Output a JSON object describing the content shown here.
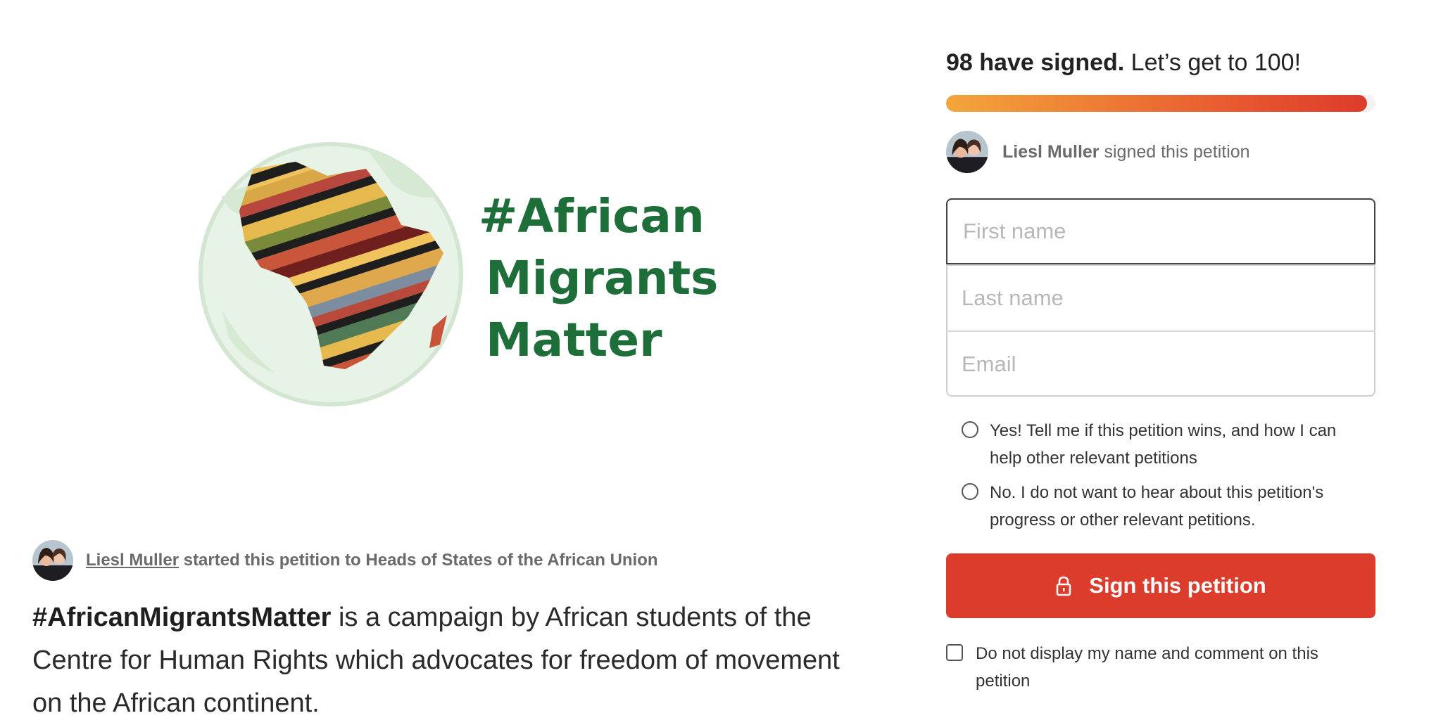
{
  "petition": {
    "hero": {
      "line1": "#African",
      "line2": "Migrants",
      "line3": "Matter"
    },
    "starter": {
      "name": "Liesl Muller",
      "suffix": " started this petition to Heads of States of the African Union"
    },
    "description": {
      "hashtag": "#AfricanMigrantsMatter",
      "text": " is a campaign by African students of the Centre for Human Rights which advocates for freedom of movement on the African continent."
    }
  },
  "signature": {
    "count_bold": "98 have signed.",
    "count_rest": " Let’s get to 100!",
    "signed": 98,
    "goal": 100,
    "recent": {
      "name": "Liesl Muller",
      "action": " signed this petition"
    },
    "form": {
      "first_name_placeholder": "First name",
      "last_name_placeholder": "Last name",
      "email_placeholder": "Email"
    },
    "options": {
      "yes": "Yes! Tell me if this petition wins, and how I can help other relevant petitions",
      "no": "No. I do not want to hear about this petition's progress or other relevant petitions."
    },
    "sign_button": "Sign this petition",
    "hide_name": "Do not display my name and comment on this petition"
  },
  "colors": {
    "primary": "#dc3c2c",
    "progress_start": "#f3a63b",
    "logo_green": "#1e6e39"
  }
}
